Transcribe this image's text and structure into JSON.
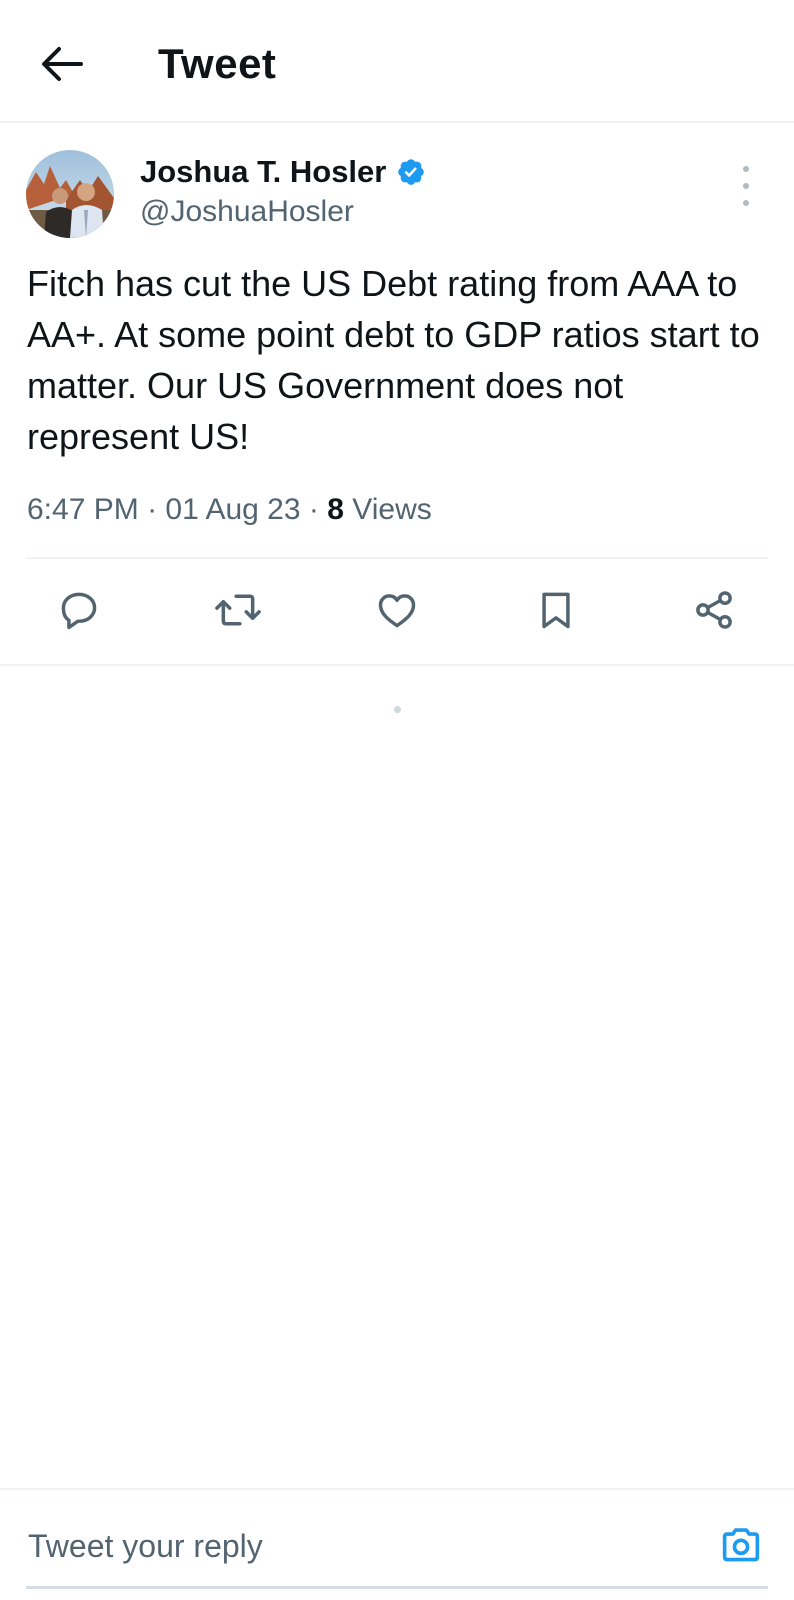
{
  "header": {
    "title": "Tweet",
    "back_icon": "arrow-left-icon"
  },
  "tweet": {
    "author": {
      "name": "Joshua T. Hosler",
      "handle": "@JoshuaHosler",
      "verified": true,
      "verified_color": "#1d9bf0"
    },
    "text": "Fitch has cut the US Debt rating from AAA to AA+. At some point debt to GDP ratios start to matter. Our US Government does not represent US!",
    "time": "6:47 PM",
    "date": "01 Aug 23",
    "views_count": "8",
    "views_label": "Views",
    "separator": "·"
  },
  "actions": [
    {
      "name": "reply",
      "icon": "comment-icon"
    },
    {
      "name": "retweet",
      "icon": "retweet-icon"
    },
    {
      "name": "like",
      "icon": "heart-icon"
    },
    {
      "name": "bookmark",
      "icon": "bookmark-icon"
    },
    {
      "name": "share",
      "icon": "share-icon"
    }
  ],
  "reply": {
    "placeholder": "Tweet your reply",
    "camera_icon": "camera-icon",
    "accent_color": "#1d9bf0"
  },
  "colors": {
    "text_primary": "#0f1419",
    "text_secondary": "#536471",
    "divider": "#eff3f4",
    "accent": "#1d9bf0"
  }
}
